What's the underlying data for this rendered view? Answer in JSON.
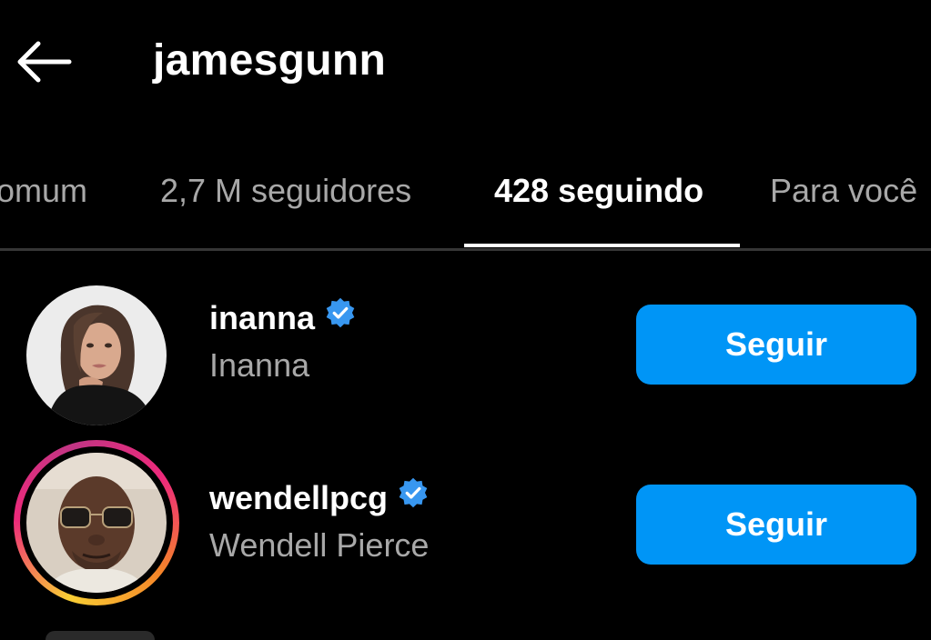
{
  "header": {
    "back_icon": "arrow-left-icon",
    "title": "jamesgunn"
  },
  "tabs": [
    {
      "label": "omum",
      "active": false
    },
    {
      "label": "2,7 M seguidores",
      "active": false
    },
    {
      "label": "428 seguindo",
      "active": true
    },
    {
      "label": "Para você",
      "active": false
    }
  ],
  "list": {
    "items": [
      {
        "username": "inanna",
        "full_name": "Inanna",
        "verified": true,
        "has_story": false,
        "button_label": "Seguir"
      },
      {
        "username": "wendellpcg",
        "full_name": "Wendell Pierce",
        "verified": true,
        "has_story": true,
        "button_label": "Seguir"
      }
    ]
  },
  "colors": {
    "background": "#000000",
    "accent": "#0095f6",
    "muted_text": "#a8a8a8",
    "verified_badge": "#3897f0"
  }
}
